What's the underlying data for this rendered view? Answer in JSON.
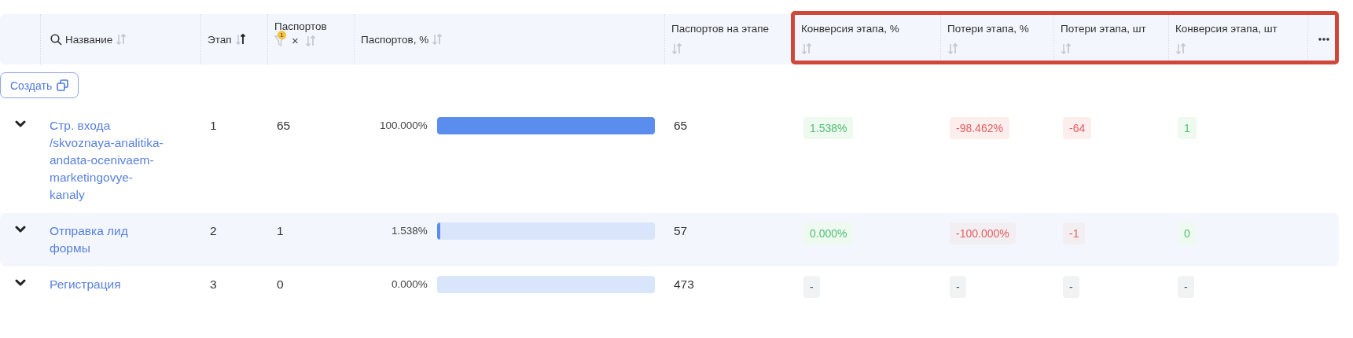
{
  "table": {
    "columns": [
      {
        "label": "Название",
        "kind": "search",
        "sorted": false
      },
      {
        "label": "Этап",
        "kind": "plain",
        "sorted": true
      },
      {
        "label": "Паспортов",
        "kind": "filter",
        "sorted": false,
        "filter_count": "1",
        "clear": "×"
      },
      {
        "label": "Паспортов, %",
        "kind": "plain",
        "sorted": false
      },
      {
        "label": "Паспортов на этапе",
        "kind": "stacked",
        "sorted": false
      },
      {
        "label": "Конверсия этапа, %",
        "kind": "stacked",
        "sorted": false
      },
      {
        "label": "Потери этапа, %",
        "kind": "stacked",
        "sorted": false
      },
      {
        "label": "Потери этапа, шт",
        "kind": "stacked",
        "sorted": false
      },
      {
        "label": "Конверсия этапа, шт",
        "kind": "stacked",
        "sorted": false
      }
    ],
    "create_button": "Создать",
    "rows": [
      {
        "highlighted": false,
        "name": "Стр. входа /skvoznaya-analitika-andata-ocenivaem-marketingovye-kanaly",
        "stage": "1",
        "passports": "65",
        "percent": "100.000%",
        "level": 1,
        "on_stage": "65",
        "metrics": [
          {
            "text": "1.538%",
            "kind": "positive"
          },
          {
            "text": "-98.462%",
            "kind": "negative"
          },
          {
            "text": "-64",
            "kind": "negative"
          },
          {
            "text": "1",
            "kind": "positive"
          }
        ]
      },
      {
        "highlighted": true,
        "name": "Отправка лид формы",
        "stage": "2",
        "passports": "1",
        "percent": "1.538%",
        "level": 0.01538,
        "on_stage": "57",
        "metrics": [
          {
            "text": "0.000%",
            "kind": "positive"
          },
          {
            "text": "-100.000%",
            "kind": "negative"
          },
          {
            "text": "-1",
            "kind": "negative"
          },
          {
            "text": "0",
            "kind": "positive"
          }
        ]
      },
      {
        "highlighted": false,
        "name": "Регистрация",
        "stage": "3",
        "passports": "0",
        "percent": "0.000%",
        "level": 0,
        "on_stage": "473",
        "metrics": [
          {
            "text": "-",
            "kind": "empty"
          },
          {
            "text": "-",
            "kind": "empty"
          },
          {
            "text": "-",
            "kind": "empty"
          },
          {
            "text": "-",
            "kind": "empty"
          }
        ]
      }
    ],
    "highlight_box": true
  }
}
